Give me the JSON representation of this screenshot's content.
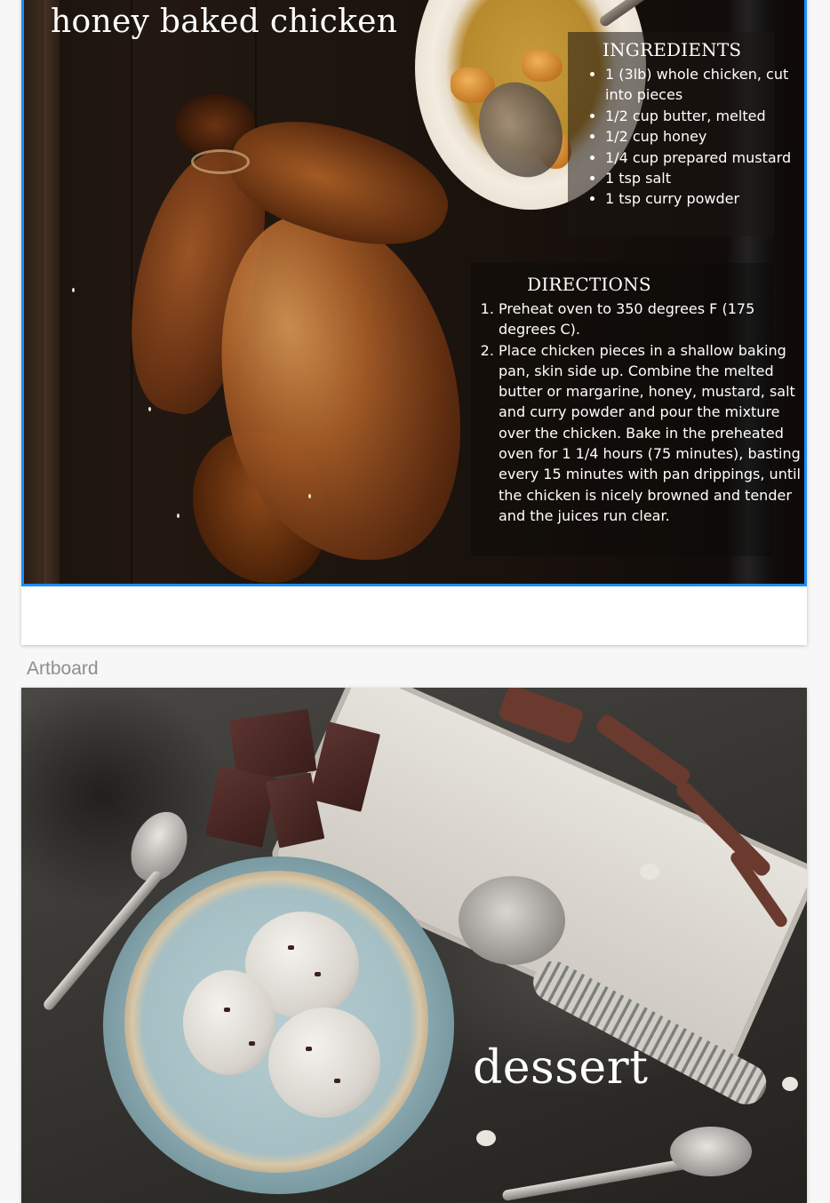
{
  "artboard_label": "Artboard",
  "recipe_card": {
    "title": "honey baked chicken",
    "ingredients_heading": "INGREDIENTS",
    "ingredients": [
      "1 (3lb) whole chicken, cut into pieces",
      "1/2 cup butter, melted",
      "1/2 cup honey",
      "1/4 cup prepared mustard",
      "1 tsp salt",
      "1 tsp curry powder"
    ],
    "directions_heading": "DIRECTIONS",
    "directions": [
      "Preheat oven to 350 degrees F (175 degrees C).",
      "Place chicken pieces in a shallow baking pan, skin side up. Combine the melted butter or margarine, honey, mustard, salt and curry powder and pour the mixture over the chicken. Bake in the preheated oven for 1 1/4 hours (75 minutes), basting every 15 minutes with pan drippings, until the chicken is nicely browned and tender and the juices run clear."
    ]
  },
  "dessert_card": {
    "title": "dessert"
  },
  "colors": {
    "selection_border": "#1a8cff",
    "canvas_background": "#f7f7f7",
    "label_text": "#8e8e8e"
  }
}
